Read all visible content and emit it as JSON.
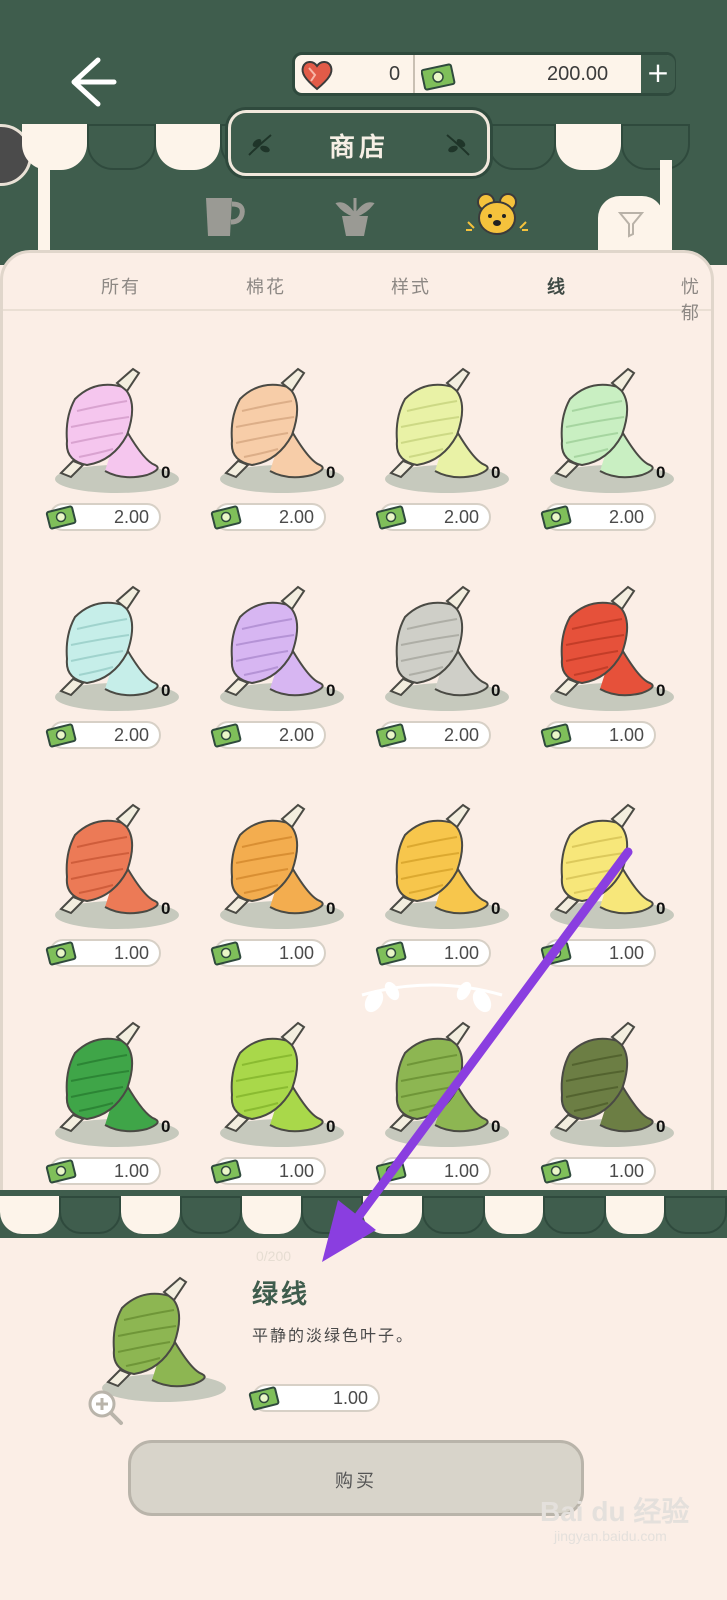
{
  "header": {
    "hearts": "0",
    "money": "200.00",
    "plus_label": "+",
    "title": "商店"
  },
  "category_icons": [
    "cup-icon",
    "plant-icon",
    "bear-icon"
  ],
  "tabs": [
    {
      "label": "所有",
      "active": false
    },
    {
      "label": "棉花",
      "active": false
    },
    {
      "label": "样式",
      "active": false
    },
    {
      "label": "线",
      "active": true
    },
    {
      "label": "忧郁",
      "active": false
    }
  ],
  "items": [
    {
      "color": "#f5c6ee",
      "dark": "#d9a3d0",
      "qty": "0",
      "price": "2.00"
    },
    {
      "color": "#f7cda8",
      "dark": "#dcae88",
      "qty": "0",
      "price": "2.00"
    },
    {
      "color": "#e9f2a6",
      "dark": "#cdd985",
      "qty": "0",
      "price": "2.00"
    },
    {
      "color": "#c9efc2",
      "dark": "#a6d5a0",
      "qty": "0",
      "price": "2.00"
    },
    {
      "color": "#c6eee9",
      "dark": "#a0d3cd",
      "qty": "0",
      "price": "2.00"
    },
    {
      "color": "#d7b6f2",
      "dark": "#b593d6",
      "qty": "0",
      "price": "2.00"
    },
    {
      "color": "#cfcfc8",
      "dark": "#aeaea6",
      "qty": "0",
      "price": "2.00"
    },
    {
      "color": "#e6513a",
      "dark": "#c33d28",
      "qty": "0",
      "price": "1.00"
    },
    {
      "color": "#ec7a56",
      "dark": "#cf5d3b",
      "qty": "0",
      "price": "1.00"
    },
    {
      "color": "#f3ad4f",
      "dark": "#d98f33",
      "qty": "0",
      "price": "1.00"
    },
    {
      "color": "#f7c64c",
      "dark": "#dca930",
      "qty": "0",
      "price": "1.00"
    },
    {
      "color": "#f7e77a",
      "dark": "#dcc95c",
      "qty": "0",
      "price": "1.00"
    },
    {
      "color": "#3fa548",
      "dark": "#2c8535",
      "qty": "0",
      "price": "1.00"
    },
    {
      "color": "#a9d84a",
      "dark": "#8abb31",
      "qty": "0",
      "price": "1.00"
    },
    {
      "color": "#8db652",
      "dark": "#6f9638",
      "qty": "0",
      "price": "1.00"
    },
    {
      "color": "#6c7e44",
      "dark": "#53632f",
      "qty": "0",
      "price": "1.00"
    }
  ],
  "detail": {
    "stock": "0/200",
    "name": "绿线",
    "description": "平静的淡绿色叶子。",
    "price": "1.00",
    "color": "#8db652",
    "dark": "#6f9638",
    "buy_label": "购买"
  },
  "watermark": {
    "brand": "Bai du 经验",
    "url": "jingyan.baidu.com"
  },
  "colors": {
    "brand_green": "#3f5d4d",
    "cream": "#fbeee6",
    "annotation_arrow": "#8a3ee0"
  }
}
